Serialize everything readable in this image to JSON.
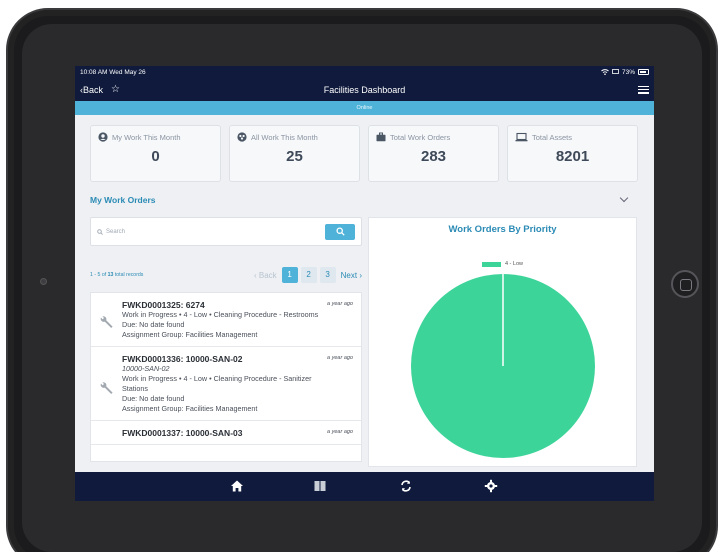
{
  "status": {
    "time": "10:08 AM",
    "date": "Wed May 26",
    "battery": "73%"
  },
  "nav": {
    "back_label": "Back",
    "title": "Facilities Dashboard"
  },
  "connection": {
    "label": "Online"
  },
  "stats": [
    {
      "label": "My Work This Month",
      "value": "0",
      "icon": "user-circle-icon"
    },
    {
      "label": "All Work This Month",
      "value": "25",
      "icon": "group-circle-icon"
    },
    {
      "label": "Total Work Orders",
      "value": "283",
      "icon": "briefcase-icon"
    },
    {
      "label": "Total Assets",
      "value": "8201",
      "icon": "laptop-icon"
    }
  ],
  "section": {
    "title": "My Work Orders"
  },
  "search": {
    "placeholder": "Search"
  },
  "pagination": {
    "range": "1 - 5",
    "of": "of",
    "total": "13",
    "suffix": "total records",
    "back": "‹ Back",
    "pages": [
      "1",
      "2",
      "3"
    ],
    "next": "Next ›"
  },
  "work_orders": [
    {
      "title": "FWKD0001325: 6274",
      "time": "a year ago",
      "line1": "Work in Progress • 4 - Low • Cleaning Procedure - Restrooms",
      "line2": "Due: No date found",
      "line3": "Assignment Group: Facilities Management"
    },
    {
      "title": "FWKD0001336: 10000-SAN-02",
      "time": "a year ago",
      "subtitle": "10000-SAN-02",
      "line1": "Work in Progress • 4 - Low • Cleaning Procedure - Sanitizer",
      "line1b": "Stations",
      "line2": "Due: No date found",
      "line3": "Assignment Group: Facilities Management"
    },
    {
      "title": "FWKD0001337: 10000-SAN-03",
      "time": "a year ago"
    }
  ],
  "chart_data": {
    "type": "pie",
    "title": "Work Orders By Priority",
    "labels": [
      "4 - Low"
    ],
    "values": [
      5
    ],
    "colors": [
      "#3dd49a"
    ],
    "legend_position": "top"
  },
  "colors": {
    "navy": "#0f1a3c",
    "accent": "#4fb3d9",
    "link": "#2b8bb5",
    "pie": "#3dd49a"
  },
  "tabs": [
    "home-icon",
    "book-icon",
    "sync-icon",
    "gear-icon"
  ]
}
